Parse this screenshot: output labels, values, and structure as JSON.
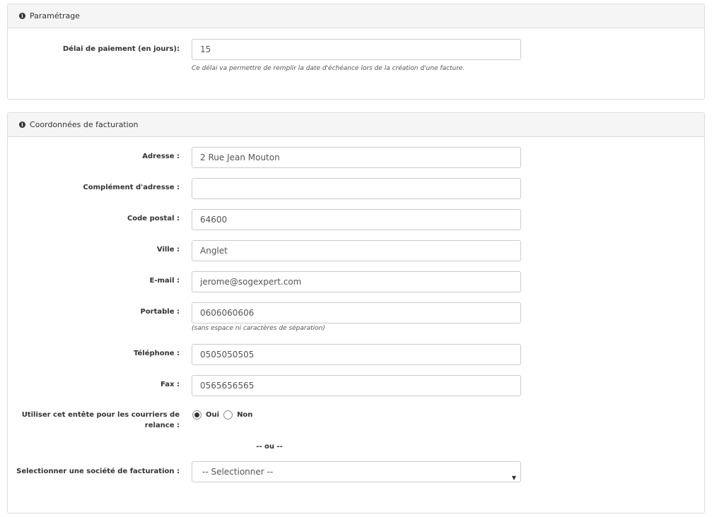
{
  "settings_panel": {
    "title": "Paramétrage",
    "payment_delay": {
      "label": "Délai de paiement (en jours):",
      "value": "15",
      "help": "Ce délai va permettre de remplir la date d'échéance lors de la création d'une facture."
    }
  },
  "billing_panel": {
    "title": "Coordonnées de facturation",
    "address": {
      "label": "Adresse :",
      "value": "2 Rue Jean Mouton"
    },
    "address_complement": {
      "label": "Complément d'adresse :",
      "value": ""
    },
    "postal_code": {
      "label": "Code postal :",
      "value": "64600"
    },
    "city": {
      "label": "Ville :",
      "value": "Anglet"
    },
    "email": {
      "label": "E-mail :",
      "value": "jerome@sogexpert.com"
    },
    "mobile": {
      "label": "Portable :",
      "value": "0606060606",
      "help": "(sans espace ni caractères de séparation)"
    },
    "phone": {
      "label": "Téléphone :",
      "value": "0505050505"
    },
    "fax": {
      "label": "Fax :",
      "value": "0565656565"
    },
    "use_header": {
      "label": "Utiliser cet entête pour les courriers de relance :",
      "options": {
        "yes": "Oui",
        "no": "Non"
      },
      "selected": "Oui"
    },
    "separator": "-- ou --",
    "billing_company": {
      "label": "Selectionner une société de facturation :",
      "selected": "-- Selectionner --"
    }
  }
}
